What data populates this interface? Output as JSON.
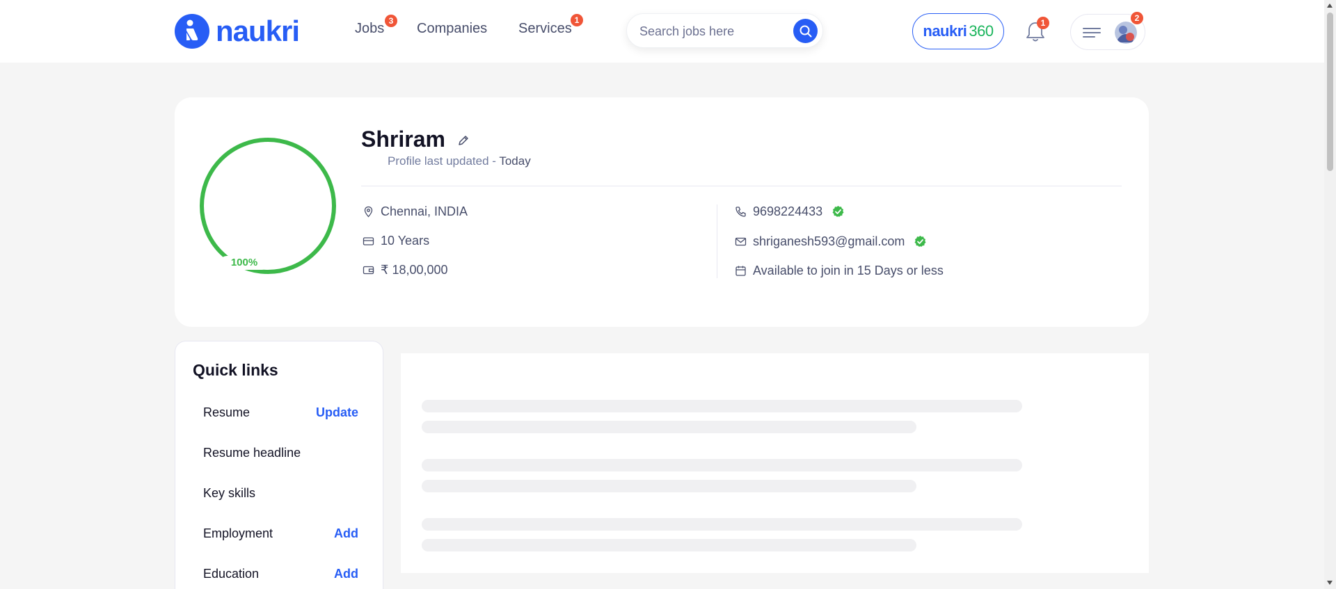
{
  "header": {
    "logo_text": "naukri",
    "nav": [
      {
        "label": "Jobs",
        "badge": "3"
      },
      {
        "label": "Companies"
      },
      {
        "label": "Services",
        "badge": "1"
      }
    ],
    "search_placeholder": "Search jobs here",
    "naukri360": {
      "word": "naukri",
      "num": "360"
    },
    "notifications_badge": "1",
    "menu_badge": "2"
  },
  "profile": {
    "name": "Shriram",
    "completion": "100%",
    "completion_fraction": 1.0,
    "updated_label": "Profile last updated - ",
    "updated_when": "Today",
    "location": "Chennai, INDIA",
    "experience": "10 Years",
    "salary": "₹ 18,00,000",
    "phone": "9698224433",
    "email": "shriganesh593@gmail.com",
    "availability": "Available to join in 15 Days or less"
  },
  "quick_links": {
    "title": "Quick links",
    "items": [
      {
        "label": "Resume",
        "action": "Update"
      },
      {
        "label": "Resume headline",
        "action": ""
      },
      {
        "label": "Key skills",
        "action": ""
      },
      {
        "label": "Employment",
        "action": "Add"
      },
      {
        "label": "Education",
        "action": "Add"
      }
    ]
  },
  "colors": {
    "brand_blue": "#275df5",
    "completion_green": "#3db94a",
    "verified_green": "#3db94a",
    "badge_red": "#f05537"
  },
  "icons": [
    "search-icon",
    "bell-icon",
    "hamburger-menu-icon",
    "edit-pencil-icon",
    "location-pin-icon",
    "briefcase-icon",
    "wallet-icon",
    "phone-icon",
    "mail-icon",
    "calendar-icon",
    "verified-check-icon"
  ]
}
